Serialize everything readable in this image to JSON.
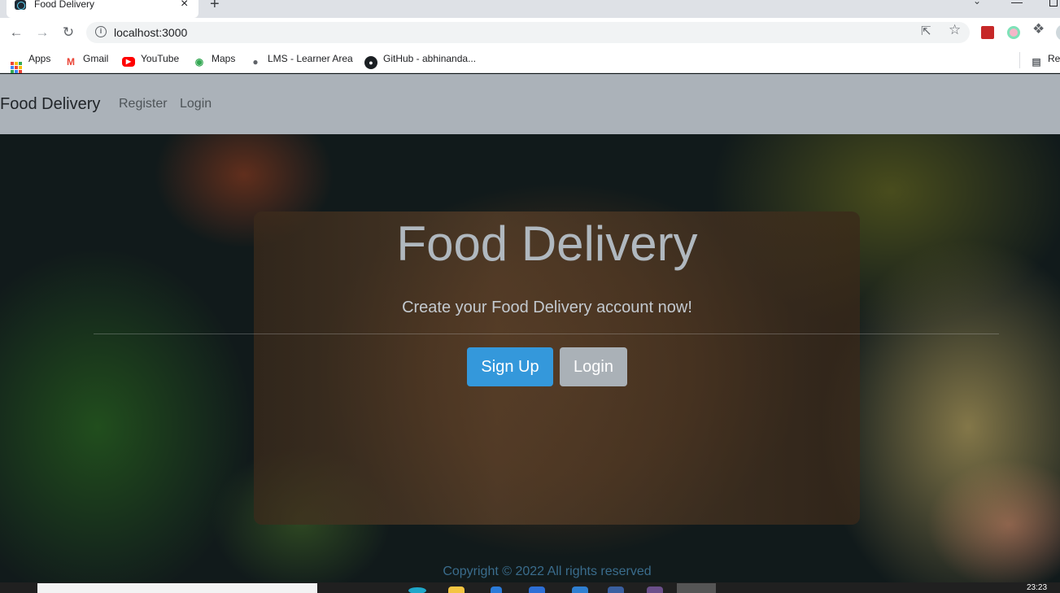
{
  "browser": {
    "tab_title": "Food Delivery",
    "tab_close": "×",
    "new_tab": "+",
    "url": "localhost:3000",
    "bookmarks": [
      {
        "label": "Apps"
      },
      {
        "label": "Gmail"
      },
      {
        "label": "YouTube"
      },
      {
        "label": "Maps"
      },
      {
        "label": "LMS - Learner Area"
      },
      {
        "label": "GitHub - abhinanda..."
      }
    ],
    "reading_list": "Rea"
  },
  "navbar": {
    "brand": "Food Delivery",
    "links": [
      {
        "label": "Register"
      },
      {
        "label": "Login"
      }
    ]
  },
  "hero": {
    "title": "Food Delivery",
    "lead": "Create your Food Delivery account now!",
    "signup_label": "Sign Up",
    "login_label": "Login"
  },
  "footer": {
    "text": "Copyright © 2022 All rights reserved"
  },
  "taskbar": {
    "clock": "23:23"
  },
  "colors": {
    "navbar_bg": "#abb2b9",
    "signup_bg": "#3498db",
    "login_bg": "#aab1b7"
  }
}
